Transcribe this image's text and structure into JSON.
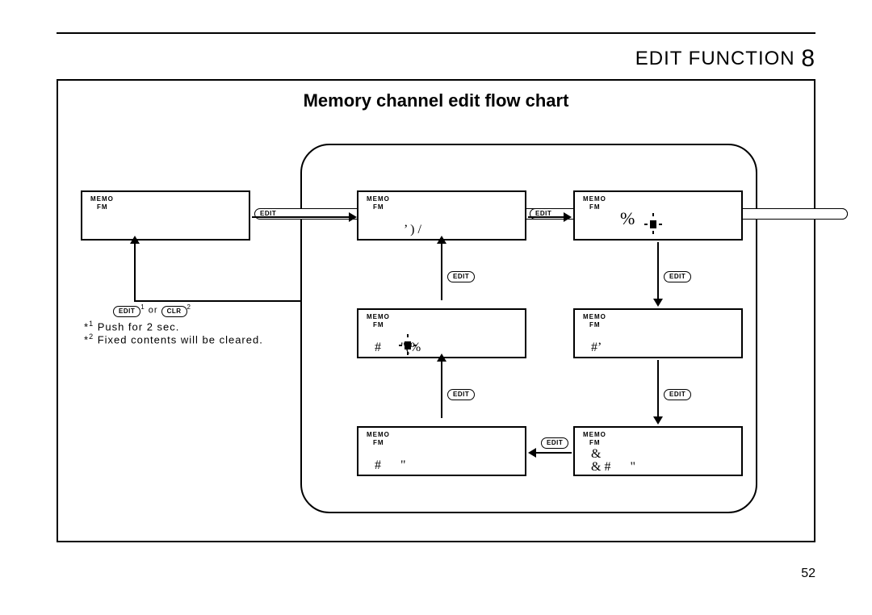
{
  "header": {
    "title": "EDIT FUNCTION",
    "section_number": "8"
  },
  "chart": {
    "title": "Memory channel edit ﬂow chart"
  },
  "labels": {
    "memo": "MEMO",
    "fm": "FM",
    "edit": "EDIT",
    "clr": "CLR",
    "or": "or"
  },
  "notes": {
    "note1_prefix": "*",
    "note1_sup": "1",
    "note1_text": " Push for 2 sec.",
    "note2_prefix": "*",
    "note2_sup": "2",
    "note2_text": " Fixed contents will be cleared."
  },
  "display_text": {
    "d2_top": "’ ) /",
    "d3_top": "%",
    "d4": "#      \"(%",
    "d5": "#’",
    "d6": "#      \"",
    "d7a": "&",
    "d7b": "& #      \""
  },
  "page_number": "52"
}
